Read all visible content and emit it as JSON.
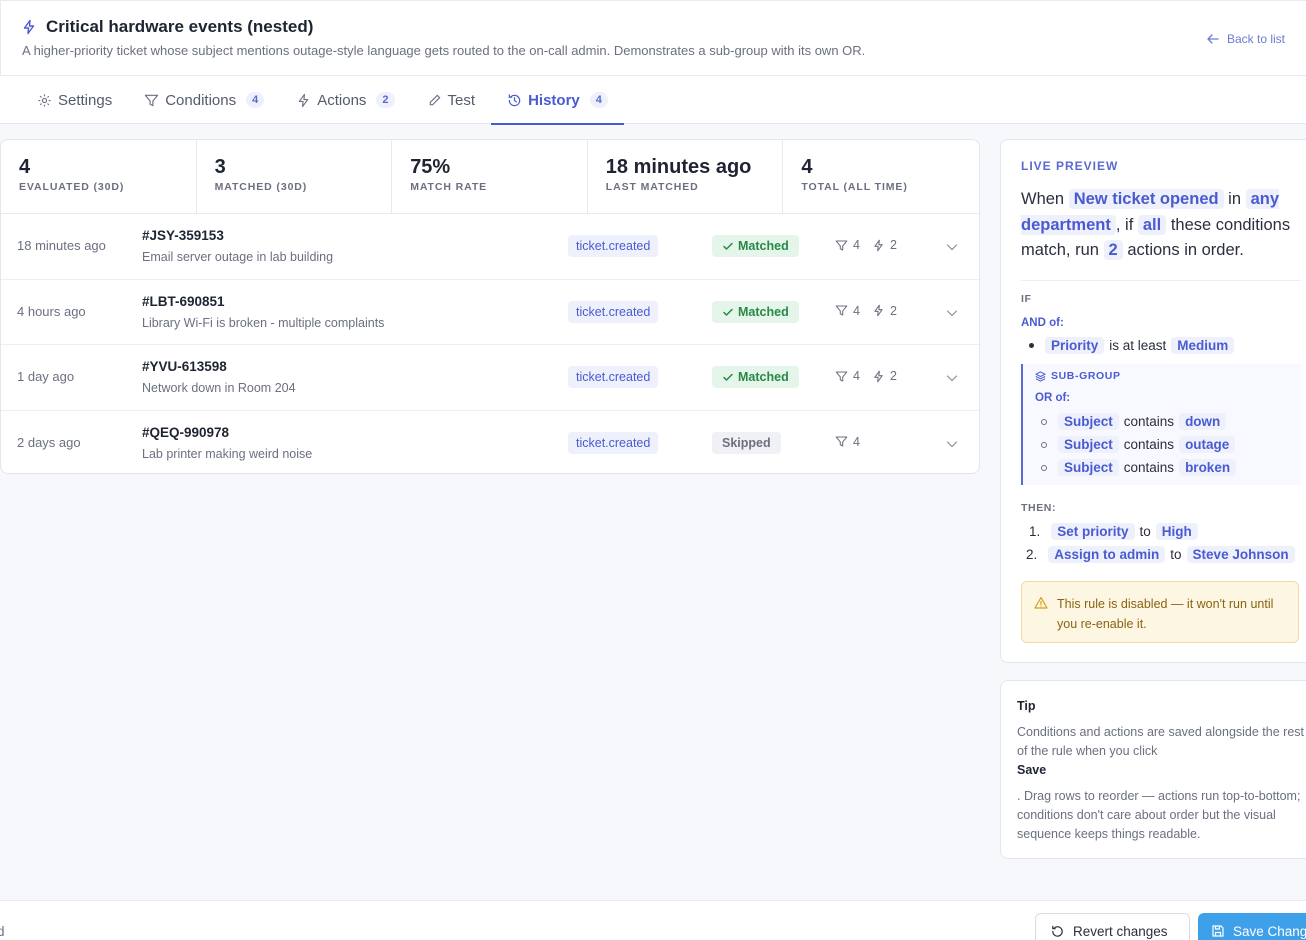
{
  "header": {
    "title": "Critical hardware events (nested)",
    "subtitle": "A higher-priority ticket whose subject mentions outage-style language gets routed to the on-call admin. Demonstrates a sub-group with its own OR.",
    "back_label": "Back to list"
  },
  "tabs": [
    {
      "label": "Settings",
      "count": ""
    },
    {
      "label": "Conditions",
      "count": "4"
    },
    {
      "label": "Actions",
      "count": "2"
    },
    {
      "label": "Test",
      "count": ""
    },
    {
      "label": "History",
      "count": "4"
    }
  ],
  "stats": [
    {
      "value": "4",
      "label": "EVALUATED (30D)"
    },
    {
      "value": "3",
      "label": "MATCHED (30D)"
    },
    {
      "value": "75%",
      "label": "MATCH RATE"
    },
    {
      "value": "18 minutes ago",
      "label": "LAST MATCHED"
    },
    {
      "value": "4",
      "label": "TOTAL (ALL TIME)"
    }
  ],
  "history": [
    {
      "time": "18 minutes ago",
      "id": "#JSY-359153",
      "subject": "Email server outage in lab building",
      "event": "ticket.created",
      "status": "Matched",
      "conditions": "4",
      "actions": "2"
    },
    {
      "time": "4 hours ago",
      "id": "#LBT-690851",
      "subject": "Library Wi-Fi is broken - multiple complaints",
      "event": "ticket.created",
      "status": "Matched",
      "conditions": "4",
      "actions": "2"
    },
    {
      "time": "1 day ago",
      "id": "#YVU-613598",
      "subject": "Network down in Room 204",
      "event": "ticket.created",
      "status": "Matched",
      "conditions": "4",
      "actions": "2"
    },
    {
      "time": "2 days ago",
      "id": "#QEQ-990978",
      "subject": "Lab printer making weird noise",
      "event": "ticket.created",
      "status": "Skipped",
      "conditions": "4",
      "actions": ""
    }
  ],
  "preview": {
    "title": "LIVE PREVIEW",
    "s_when": "When",
    "s_trigger": "New ticket opened",
    "s_in": "in",
    "s_dept": "any department",
    "s_if": ", if",
    "s_all": "all",
    "s_these": "these conditions match, run",
    "s_count": "2",
    "s_actions": "actions in order.",
    "if_label": "IF",
    "and_label": "AND of:",
    "cond1": {
      "field": "Priority",
      "op": "is at least",
      "value": "Medium"
    },
    "subgroup_label": "SUB-GROUP",
    "or_label": "OR of:",
    "or_conditions": [
      {
        "field": "Subject",
        "op": "contains",
        "value": "down"
      },
      {
        "field": "Subject",
        "op": "contains",
        "value": "outage"
      },
      {
        "field": "Subject",
        "op": "contains",
        "value": "broken"
      }
    ],
    "then_label": "THEN:",
    "actions": [
      {
        "num": "1.",
        "action": "Set priority",
        "to": "to",
        "value": "High"
      },
      {
        "num": "2.",
        "action": "Assign to admin",
        "to": "to",
        "value": "Steve Johnson"
      }
    ],
    "warning": "This rule is disabled — it won't run until you re-enable it."
  },
  "tip": {
    "title": "Tip",
    "p1": "Conditions and actions are saved alongside the rest of the rule when you click",
    "save": "Save",
    "p2": ". Drag rows to reorder — actions run top-to-bottom; conditions don't care about order but the visual sequence keeps things readable."
  },
  "footer": {
    "left_text": "d",
    "revert_label": "Revert changes",
    "save_label": "Save Changes"
  }
}
